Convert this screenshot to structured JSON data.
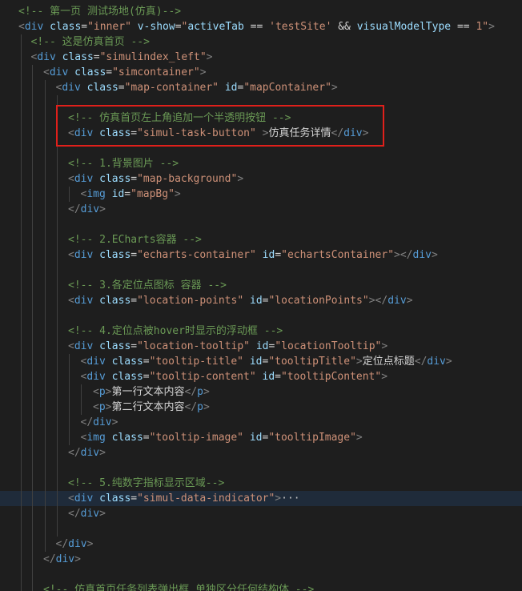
{
  "colors": {
    "background": "#1e1e1e",
    "comment": "#6a9955",
    "tag_bracket": "#808080",
    "tag_name": "#569cd6",
    "attr_name": "#9cdcfe",
    "attr_value": "#ce9178",
    "text": "#d4d4d4",
    "highlight_border": "#e0201b",
    "current_line": "#1f2b3a"
  },
  "highlight_box": {
    "label": "red-annotation-box",
    "covers_lines": [
      7,
      8
    ]
  },
  "code_lines": [
    {
      "indent": 0,
      "tokens": [
        {
          "t": "cm",
          "v": "<!-- 第一页 测试场地(仿真)-->"
        }
      ]
    },
    {
      "indent": 0,
      "tokens": [
        {
          "t": "tg",
          "v": "<"
        },
        {
          "t": "tn",
          "v": "div"
        },
        {
          "t": "tx",
          "v": " "
        },
        {
          "t": "an",
          "v": "class"
        },
        {
          "t": "tx",
          "v": "="
        },
        {
          "t": "av",
          "v": "\"inner\""
        },
        {
          "t": "tx",
          "v": " "
        },
        {
          "t": "an",
          "v": "v-show"
        },
        {
          "t": "tx",
          "v": "="
        },
        {
          "t": "av",
          "v": "\""
        },
        {
          "t": "an",
          "v": "activeTab"
        },
        {
          "t": "tx",
          "v": " == "
        },
        {
          "t": "av",
          "v": "'testSite'"
        },
        {
          "t": "tx",
          "v": " && "
        },
        {
          "t": "an",
          "v": "visualModelType"
        },
        {
          "t": "tx",
          "v": " == "
        },
        {
          "t": "av",
          "v": "1\""
        },
        {
          "t": "tg",
          "v": ">"
        }
      ]
    },
    {
      "indent": 1,
      "tokens": [
        {
          "t": "cm",
          "v": "<!-- 这是仿真首页 -->"
        }
      ]
    },
    {
      "indent": 1,
      "tokens": [
        {
          "t": "tg",
          "v": "<"
        },
        {
          "t": "tn",
          "v": "div"
        },
        {
          "t": "tx",
          "v": " "
        },
        {
          "t": "an",
          "v": "class"
        },
        {
          "t": "tx",
          "v": "="
        },
        {
          "t": "av",
          "v": "\"simulindex_left\""
        },
        {
          "t": "tg",
          "v": ">"
        }
      ]
    },
    {
      "indent": 2,
      "tokens": [
        {
          "t": "tg",
          "v": "<"
        },
        {
          "t": "tn",
          "v": "div"
        },
        {
          "t": "tx",
          "v": " "
        },
        {
          "t": "an",
          "v": "class"
        },
        {
          "t": "tx",
          "v": "="
        },
        {
          "t": "av",
          "v": "\"simcontainer\""
        },
        {
          "t": "tg",
          "v": ">"
        }
      ]
    },
    {
      "indent": 3,
      "tokens": [
        {
          "t": "tg",
          "v": "<"
        },
        {
          "t": "tn",
          "v": "div"
        },
        {
          "t": "tx",
          "v": " "
        },
        {
          "t": "an",
          "v": "class"
        },
        {
          "t": "tx",
          "v": "="
        },
        {
          "t": "av",
          "v": "\"map-container\""
        },
        {
          "t": "tx",
          "v": " "
        },
        {
          "t": "an",
          "v": "id"
        },
        {
          "t": "tx",
          "v": "="
        },
        {
          "t": "av",
          "v": "\"mapContainer\""
        },
        {
          "t": "tg",
          "v": ">"
        }
      ]
    },
    {
      "indent": 4,
      "tokens": []
    },
    {
      "indent": 4,
      "tokens": [
        {
          "t": "cm",
          "v": "<!-- 仿真首页左上角追加一个半透明按钮 -->"
        }
      ]
    },
    {
      "indent": 4,
      "tokens": [
        {
          "t": "tg",
          "v": "<"
        },
        {
          "t": "tn",
          "v": "div"
        },
        {
          "t": "tx",
          "v": " "
        },
        {
          "t": "an",
          "v": "class"
        },
        {
          "t": "tx",
          "v": "="
        },
        {
          "t": "av",
          "v": "\"simul-task-button\""
        },
        {
          "t": "tx",
          "v": " "
        },
        {
          "t": "tg",
          "v": ">"
        },
        {
          "t": "tx",
          "v": "仿真任务详情"
        },
        {
          "t": "tg",
          "v": "</"
        },
        {
          "t": "tn",
          "v": "div"
        },
        {
          "t": "tg",
          "v": ">"
        }
      ]
    },
    {
      "indent": 4,
      "tokens": []
    },
    {
      "indent": 4,
      "tokens": [
        {
          "t": "cm",
          "v": "<!-- 1.背景图片 -->"
        }
      ]
    },
    {
      "indent": 4,
      "tokens": [
        {
          "t": "tg",
          "v": "<"
        },
        {
          "t": "tn",
          "v": "div"
        },
        {
          "t": "tx",
          "v": " "
        },
        {
          "t": "an",
          "v": "class"
        },
        {
          "t": "tx",
          "v": "="
        },
        {
          "t": "av",
          "v": "\"map-background\""
        },
        {
          "t": "tg",
          "v": ">"
        }
      ]
    },
    {
      "indent": 5,
      "tokens": [
        {
          "t": "tg",
          "v": "<"
        },
        {
          "t": "tn",
          "v": "img"
        },
        {
          "t": "tx",
          "v": " "
        },
        {
          "t": "an",
          "v": "id"
        },
        {
          "t": "tx",
          "v": "="
        },
        {
          "t": "av",
          "v": "\"mapBg\""
        },
        {
          "t": "tg",
          "v": ">"
        }
      ]
    },
    {
      "indent": 4,
      "tokens": [
        {
          "t": "tg",
          "v": "</"
        },
        {
          "t": "tn",
          "v": "div"
        },
        {
          "t": "tg",
          "v": ">"
        }
      ]
    },
    {
      "indent": 4,
      "tokens": []
    },
    {
      "indent": 4,
      "tokens": [
        {
          "t": "cm",
          "v": "<!-- 2.ECharts容器 -->"
        }
      ]
    },
    {
      "indent": 4,
      "tokens": [
        {
          "t": "tg",
          "v": "<"
        },
        {
          "t": "tn",
          "v": "div"
        },
        {
          "t": "tx",
          "v": " "
        },
        {
          "t": "an",
          "v": "class"
        },
        {
          "t": "tx",
          "v": "="
        },
        {
          "t": "av",
          "v": "\"echarts-container\""
        },
        {
          "t": "tx",
          "v": " "
        },
        {
          "t": "an",
          "v": "id"
        },
        {
          "t": "tx",
          "v": "="
        },
        {
          "t": "av",
          "v": "\"echartsContainer\""
        },
        {
          "t": "tg",
          "v": "></"
        },
        {
          "t": "tn",
          "v": "div"
        },
        {
          "t": "tg",
          "v": ">"
        }
      ]
    },
    {
      "indent": 4,
      "tokens": []
    },
    {
      "indent": 4,
      "tokens": [
        {
          "t": "cm",
          "v": "<!-- 3.各定位点图标 容器 -->"
        }
      ]
    },
    {
      "indent": 4,
      "tokens": [
        {
          "t": "tg",
          "v": "<"
        },
        {
          "t": "tn",
          "v": "div"
        },
        {
          "t": "tx",
          "v": " "
        },
        {
          "t": "an",
          "v": "class"
        },
        {
          "t": "tx",
          "v": "="
        },
        {
          "t": "av",
          "v": "\"location-points\""
        },
        {
          "t": "tx",
          "v": " "
        },
        {
          "t": "an",
          "v": "id"
        },
        {
          "t": "tx",
          "v": "="
        },
        {
          "t": "av",
          "v": "\"locationPoints\""
        },
        {
          "t": "tg",
          "v": "></"
        },
        {
          "t": "tn",
          "v": "div"
        },
        {
          "t": "tg",
          "v": ">"
        }
      ]
    },
    {
      "indent": 4,
      "tokens": []
    },
    {
      "indent": 4,
      "tokens": [
        {
          "t": "cm",
          "v": "<!-- 4.定位点被hover时显示的浮动框 -->"
        }
      ]
    },
    {
      "indent": 4,
      "tokens": [
        {
          "t": "tg",
          "v": "<"
        },
        {
          "t": "tn",
          "v": "div"
        },
        {
          "t": "tx",
          "v": " "
        },
        {
          "t": "an",
          "v": "class"
        },
        {
          "t": "tx",
          "v": "="
        },
        {
          "t": "av",
          "v": "\"location-tooltip\""
        },
        {
          "t": "tx",
          "v": " "
        },
        {
          "t": "an",
          "v": "id"
        },
        {
          "t": "tx",
          "v": "="
        },
        {
          "t": "av",
          "v": "\"locationTooltip\""
        },
        {
          "t": "tg",
          "v": ">"
        }
      ]
    },
    {
      "indent": 5,
      "tokens": [
        {
          "t": "tg",
          "v": "<"
        },
        {
          "t": "tn",
          "v": "div"
        },
        {
          "t": "tx",
          "v": " "
        },
        {
          "t": "an",
          "v": "class"
        },
        {
          "t": "tx",
          "v": "="
        },
        {
          "t": "av",
          "v": "\"tooltip-title\""
        },
        {
          "t": "tx",
          "v": " "
        },
        {
          "t": "an",
          "v": "id"
        },
        {
          "t": "tx",
          "v": "="
        },
        {
          "t": "av",
          "v": "\"tooltipTitle\""
        },
        {
          "t": "tg",
          "v": ">"
        },
        {
          "t": "tx",
          "v": "定位点标题"
        },
        {
          "t": "tg",
          "v": "</"
        },
        {
          "t": "tn",
          "v": "div"
        },
        {
          "t": "tg",
          "v": ">"
        }
      ]
    },
    {
      "indent": 5,
      "tokens": [
        {
          "t": "tg",
          "v": "<"
        },
        {
          "t": "tn",
          "v": "div"
        },
        {
          "t": "tx",
          "v": " "
        },
        {
          "t": "an",
          "v": "class"
        },
        {
          "t": "tx",
          "v": "="
        },
        {
          "t": "av",
          "v": "\"tooltip-content\""
        },
        {
          "t": "tx",
          "v": " "
        },
        {
          "t": "an",
          "v": "id"
        },
        {
          "t": "tx",
          "v": "="
        },
        {
          "t": "av",
          "v": "\"tooltipContent\""
        },
        {
          "t": "tg",
          "v": ">"
        }
      ]
    },
    {
      "indent": 6,
      "tokens": [
        {
          "t": "tg",
          "v": "<"
        },
        {
          "t": "tn",
          "v": "p"
        },
        {
          "t": "tg",
          "v": ">"
        },
        {
          "t": "tx",
          "v": "第一行文本内容"
        },
        {
          "t": "tg",
          "v": "</"
        },
        {
          "t": "tn",
          "v": "p"
        },
        {
          "t": "tg",
          "v": ">"
        }
      ]
    },
    {
      "indent": 6,
      "tokens": [
        {
          "t": "tg",
          "v": "<"
        },
        {
          "t": "tn",
          "v": "p"
        },
        {
          "t": "tg",
          "v": ">"
        },
        {
          "t": "tx",
          "v": "第二行文本内容"
        },
        {
          "t": "tg",
          "v": "</"
        },
        {
          "t": "tn",
          "v": "p"
        },
        {
          "t": "tg",
          "v": ">"
        }
      ]
    },
    {
      "indent": 5,
      "tokens": [
        {
          "t": "tg",
          "v": "</"
        },
        {
          "t": "tn",
          "v": "div"
        },
        {
          "t": "tg",
          "v": ">"
        }
      ]
    },
    {
      "indent": 5,
      "tokens": [
        {
          "t": "tg",
          "v": "<"
        },
        {
          "t": "tn",
          "v": "img"
        },
        {
          "t": "tx",
          "v": " "
        },
        {
          "t": "an",
          "v": "class"
        },
        {
          "t": "tx",
          "v": "="
        },
        {
          "t": "av",
          "v": "\"tooltip-image\""
        },
        {
          "t": "tx",
          "v": " "
        },
        {
          "t": "an",
          "v": "id"
        },
        {
          "t": "tx",
          "v": "="
        },
        {
          "t": "av",
          "v": "\"tooltipImage\""
        },
        {
          "t": "tg",
          "v": ">"
        }
      ]
    },
    {
      "indent": 4,
      "tokens": [
        {
          "t": "tg",
          "v": "</"
        },
        {
          "t": "tn",
          "v": "div"
        },
        {
          "t": "tg",
          "v": ">"
        }
      ]
    },
    {
      "indent": 4,
      "tokens": []
    },
    {
      "indent": 4,
      "tokens": [
        {
          "t": "cm",
          "v": "<!-- 5.纯数字指标显示区域-->"
        }
      ]
    },
    {
      "indent": 4,
      "current": true,
      "tokens": [
        {
          "t": "tg",
          "v": "<"
        },
        {
          "t": "tn",
          "v": "div"
        },
        {
          "t": "tx",
          "v": " "
        },
        {
          "t": "an",
          "v": "class"
        },
        {
          "t": "tx",
          "v": "="
        },
        {
          "t": "av",
          "v": "\"simul-data-indicator\""
        },
        {
          "t": "tg",
          "v": ">"
        },
        {
          "t": "fold",
          "v": "···"
        }
      ]
    },
    {
      "indent": 4,
      "tokens": [
        {
          "t": "tg",
          "v": "</"
        },
        {
          "t": "tn",
          "v": "div"
        },
        {
          "t": "tg",
          "v": ">"
        }
      ]
    },
    {
      "indent": 4,
      "tokens": []
    },
    {
      "indent": 3,
      "tokens": [
        {
          "t": "tg",
          "v": "</"
        },
        {
          "t": "tn",
          "v": "div"
        },
        {
          "t": "tg",
          "v": ">"
        }
      ]
    },
    {
      "indent": 2,
      "tokens": [
        {
          "t": "tg",
          "v": "</"
        },
        {
          "t": "tn",
          "v": "div"
        },
        {
          "t": "tg",
          "v": ">"
        }
      ]
    },
    {
      "indent": 2,
      "tokens": []
    },
    {
      "indent": 2,
      "tokens": [
        {
          "t": "cm",
          "v": "<!-- 仿真首页任务列表弹出框 单独区分任何结构体 -->"
        }
      ]
    }
  ]
}
